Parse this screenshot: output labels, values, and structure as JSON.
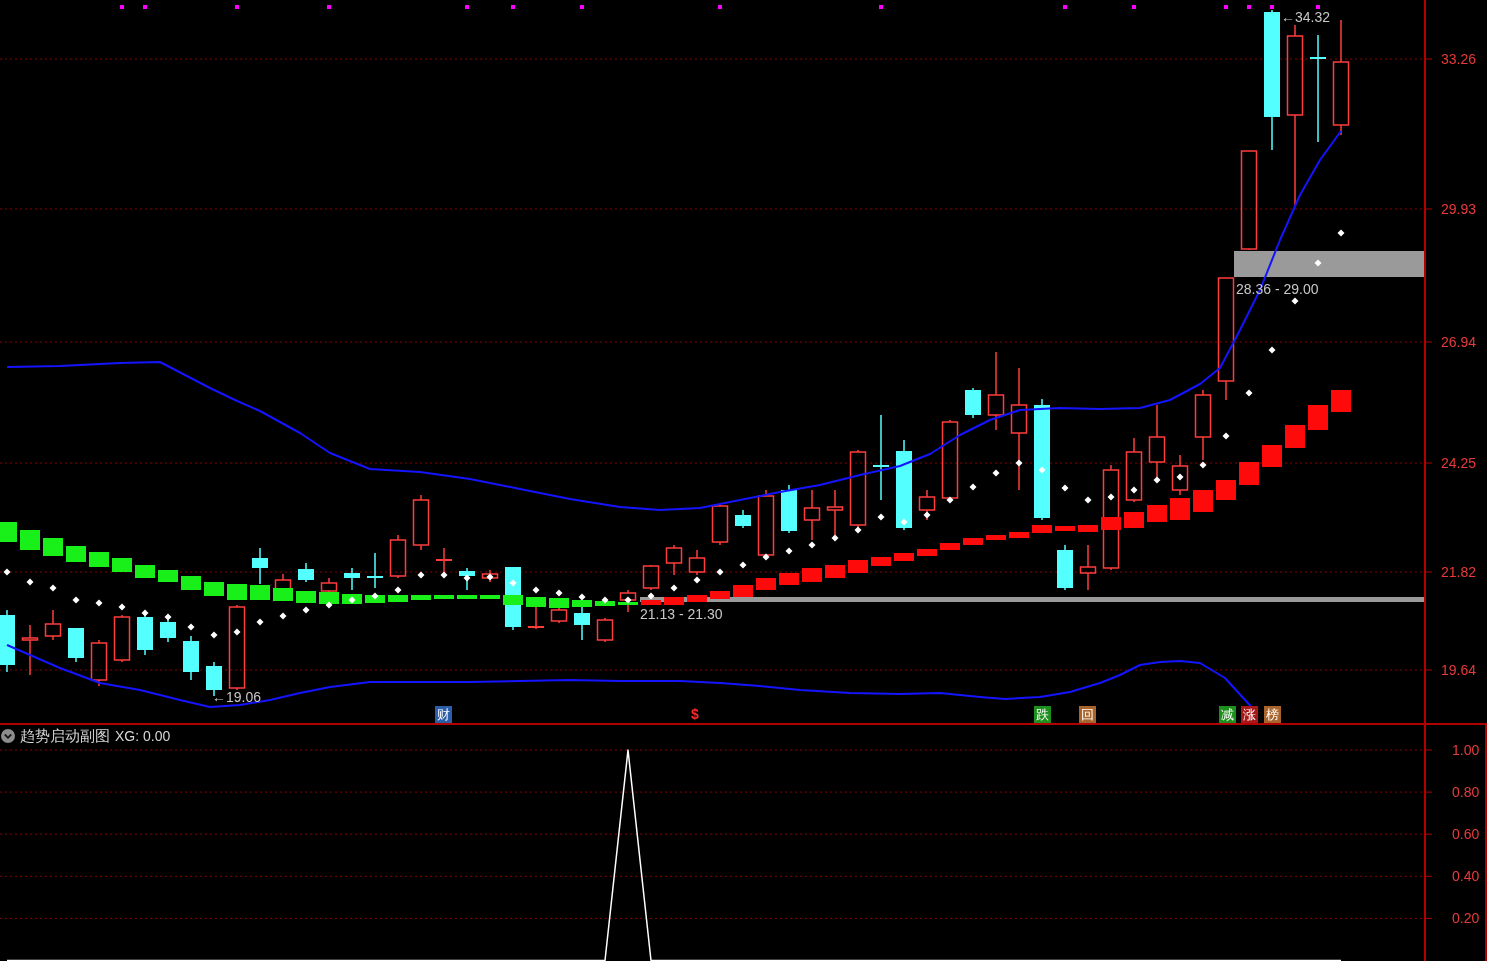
{
  "main_chart": {
    "price_axis": [
      "33.26",
      "29.93",
      "26.94",
      "24.25",
      "21.82",
      "19.64"
    ],
    "annotations": [
      "←34.32",
      "28.36 - 29.00",
      "21.13 - 21.30",
      "←19.06"
    ],
    "signals": [
      {
        "kind": "tile",
        "text": "财",
        "color": "#2a5ea8"
      },
      {
        "kind": "glyph",
        "text": "$",
        "color": "#ff2a2a"
      },
      {
        "kind": "tile",
        "text": "跌",
        "color": "#1c8f1c"
      },
      {
        "kind": "tile",
        "text": "回",
        "color": "#a8642a"
      },
      {
        "kind": "tile",
        "text": "减",
        "color": "#1c8f1c"
      },
      {
        "kind": "tile",
        "text": "涨",
        "color": "#a81818"
      },
      {
        "kind": "tile",
        "text": "榜",
        "color": "#a8642a"
      }
    ]
  },
  "sub_chart": {
    "title": "趋势启动副图",
    "readout": ": 0.00",
    "chart_data": {
      "type": "line",
      "series": [
        {
          "name": "XG",
          "color": "#ffffff",
          "values": [
            0,
            0,
            0,
            0,
            0,
            0,
            0,
            0,
            0,
            0,
            0,
            0,
            0,
            0,
            0,
            0,
            0,
            0,
            0,
            0,
            0,
            0,
            0,
            0,
            0,
            0,
            0,
            1,
            0,
            0,
            0,
            0,
            0,
            0,
            0,
            0,
            0,
            0,
            0,
            0,
            0,
            0,
            0,
            0,
            0,
            0,
            0,
            0,
            0,
            0,
            0,
            0,
            0,
            0,
            0,
            0,
            0,
            0,
            0
          ]
        }
      ],
      "ylim": [
        0,
        1
      ],
      "yticks": [
        {
          "value": 1,
          "label": "1.00"
        },
        {
          "value": 0.8,
          "label": "0.80"
        },
        {
          "value": 0.6,
          "label": "0.60"
        },
        {
          "value": 0.4,
          "label": "0.40"
        },
        {
          "value": 0.2,
          "label": "0.20"
        }
      ],
      "grid": true
    }
  }
}
